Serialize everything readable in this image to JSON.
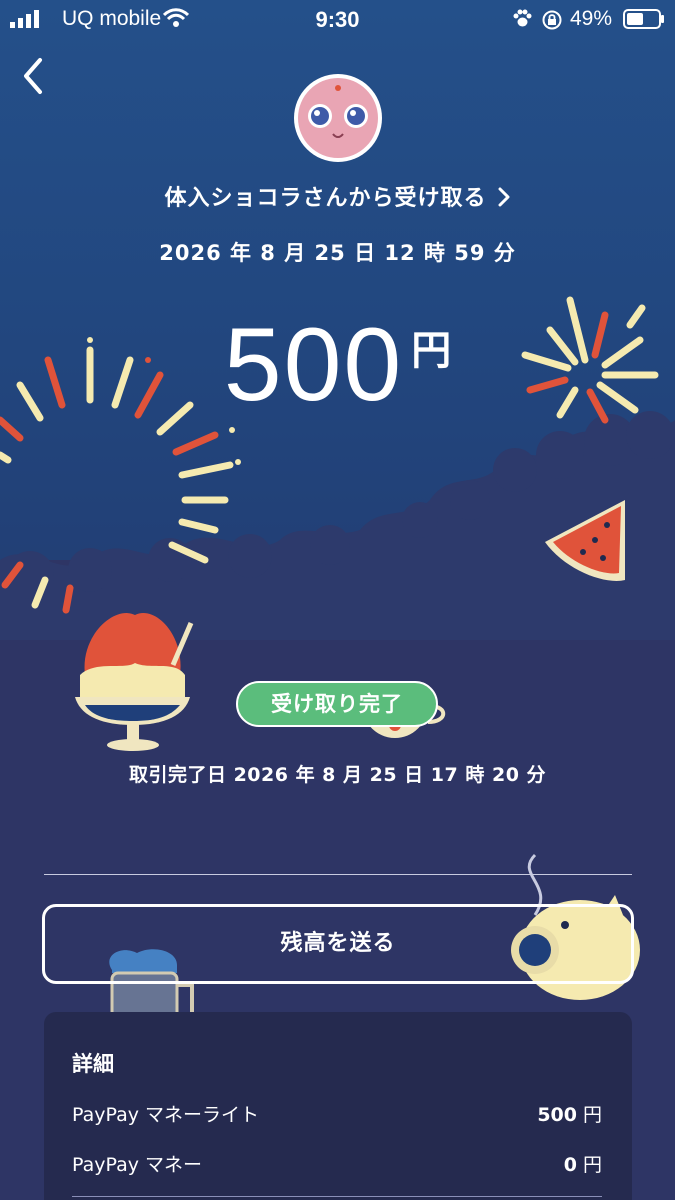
{
  "status_bar": {
    "carrier": "UQ mobile",
    "time": "9:30",
    "battery_percent": "49%",
    "icons": [
      "signal-icon",
      "wifi-icon",
      "paw-icon",
      "rotation-lock-icon",
      "battery-icon"
    ]
  },
  "header": {
    "back_icon": "chevron-left-icon",
    "avatar": "pink-character-avatar",
    "sender_text": "体入ショコラさんから受け取る",
    "sender_chevron_icon": "chevron-right-icon",
    "sent_datetime": "2026 年 8 月 25 日 12 時 59 分"
  },
  "amount": {
    "value": "500",
    "unit": "円"
  },
  "status": {
    "badge_label": "受け取り完了",
    "completed_label": "取引完了日 2026 年 8 月 25 日 17 時 20 分"
  },
  "actions": {
    "send_balance_label": "残高を送る"
  },
  "details": {
    "title": "詳細",
    "rows": [
      {
        "label": "PayPay マネーライト",
        "value": "500",
        "unit": "円"
      },
      {
        "label": "PayPay マネー",
        "value": "0",
        "unit": "円"
      }
    ]
  },
  "colors": {
    "background_top": "#24508a",
    "background_bottom": "#2e3565",
    "badge_green": "#5bbd7c",
    "card": "#252a4f",
    "firework_red": "#e0533a",
    "firework_cream": "#f5eab0"
  }
}
